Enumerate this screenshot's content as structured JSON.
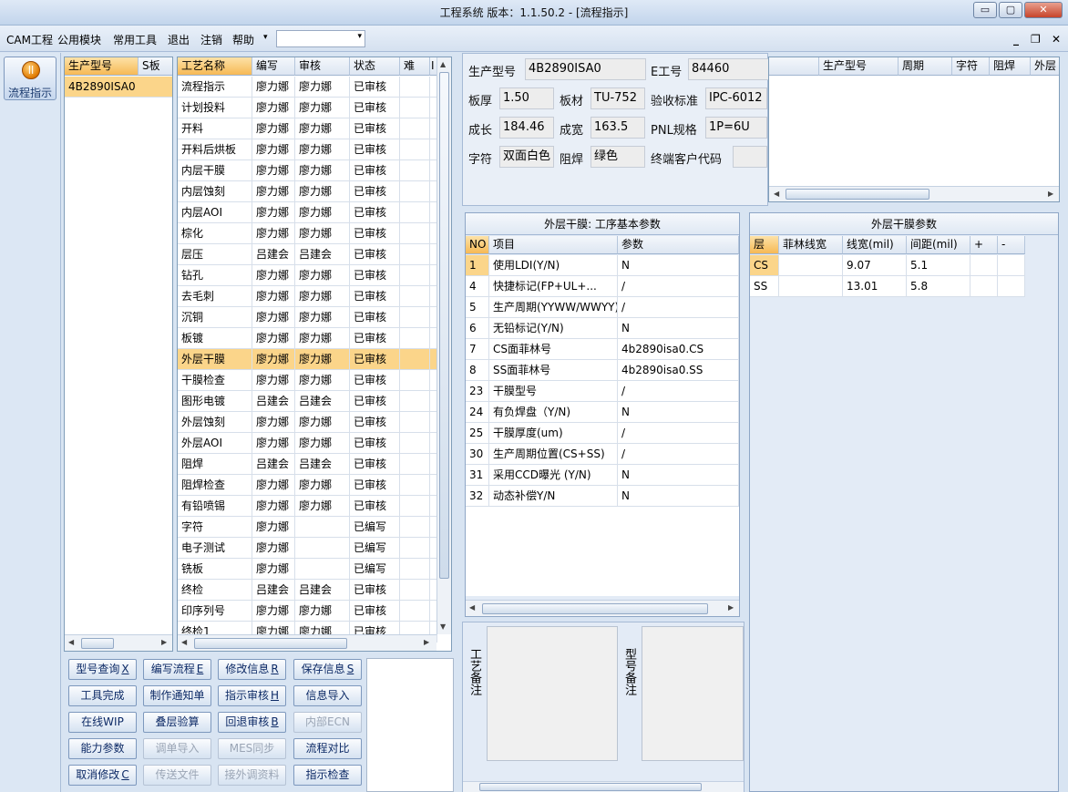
{
  "window": {
    "title": "工程系统   版本：1.1.50.2 - [流程指示]",
    "min_glyph": "▭",
    "max_glyph": "▢",
    "close_glyph": "✕"
  },
  "menu": {
    "items": [
      "CAM工程",
      "公用模块",
      "常用工具",
      "退出",
      "注销",
      "帮助"
    ],
    "dropdown_glyph": "▾",
    "combo_value": "",
    "mdi_min": "_",
    "mdi_restore": "❐",
    "mdi_close": "✕"
  },
  "launcher": {
    "flow_label": "流程指示",
    "icon_glyph": "||"
  },
  "model_grid": {
    "headers": [
      "生产型号",
      "S板"
    ],
    "rows": [
      [
        "4B2890ISA0",
        ""
      ]
    ]
  },
  "process_grid": {
    "headers": [
      "工艺名称",
      "编写",
      "审核",
      "状态",
      "难",
      "I"
    ],
    "selected_index": 13,
    "rows": [
      [
        "流程指示",
        "廖力娜",
        "廖力娜",
        "已审核"
      ],
      [
        "计划投料",
        "廖力娜",
        "廖力娜",
        "已审核"
      ],
      [
        "开料",
        "廖力娜",
        "廖力娜",
        "已审核"
      ],
      [
        "开料后烘板",
        "廖力娜",
        "廖力娜",
        "已审核"
      ],
      [
        "内层干膜",
        "廖力娜",
        "廖力娜",
        "已审核"
      ],
      [
        "内层蚀刻",
        "廖力娜",
        "廖力娜",
        "已审核"
      ],
      [
        "内层AOI",
        "廖力娜",
        "廖力娜",
        "已审核"
      ],
      [
        "棕化",
        "廖力娜",
        "廖力娜",
        "已审核"
      ],
      [
        "层压",
        "吕建会",
        "吕建会",
        "已审核"
      ],
      [
        "钻孔",
        "廖力娜",
        "廖力娜",
        "已审核"
      ],
      [
        "去毛刺",
        "廖力娜",
        "廖力娜",
        "已审核"
      ],
      [
        "沉铜",
        "廖力娜",
        "廖力娜",
        "已审核"
      ],
      [
        "板镀",
        "廖力娜",
        "廖力娜",
        "已审核"
      ],
      [
        "外层干膜",
        "廖力娜",
        "廖力娜",
        "已审核"
      ],
      [
        "干膜检查",
        "廖力娜",
        "廖力娜",
        "已审核"
      ],
      [
        "图形电镀",
        "吕建会",
        "吕建会",
        "已审核"
      ],
      [
        "外层蚀刻",
        "廖力娜",
        "廖力娜",
        "已审核"
      ],
      [
        "外层AOI",
        "廖力娜",
        "廖力娜",
        "已审核"
      ],
      [
        "阻焊",
        "吕建会",
        "吕建会",
        "已审核"
      ],
      [
        "阻焊检查",
        "廖力娜",
        "廖力娜",
        "已审核"
      ],
      [
        "有铅喷锡",
        "廖力娜",
        "廖力娜",
        "已审核"
      ],
      [
        "字符",
        "廖力娜",
        "",
        "已编写"
      ],
      [
        "电子测试",
        "廖力娜",
        "",
        "已编写"
      ],
      [
        "铣板",
        "廖力娜",
        "",
        "已编写"
      ],
      [
        "终检",
        "吕建会",
        "吕建会",
        "已审核"
      ],
      [
        "印序列号",
        "廖力娜",
        "廖力娜",
        "已审核"
      ],
      [
        "终检1",
        "廖力娜",
        "廖力娜",
        "已审核"
      ]
    ]
  },
  "actions": [
    [
      {
        "label": "型号查询",
        "key": "X",
        "enabled": true
      },
      {
        "label": "编写流程",
        "key": "E",
        "enabled": true
      },
      {
        "label": "修改信息",
        "key": "R",
        "enabled": true
      },
      {
        "label": "保存信息",
        "key": "S",
        "enabled": true
      }
    ],
    [
      {
        "label": "工具完成",
        "key": "",
        "enabled": true
      },
      {
        "label": "制作通知单",
        "key": "",
        "enabled": true
      },
      {
        "label": "指示审核",
        "key": "H",
        "enabled": true
      },
      {
        "label": "信息导入",
        "key": "",
        "enabled": true
      }
    ],
    [
      {
        "label": "在线WIP",
        "key": "",
        "enabled": true
      },
      {
        "label": "叠层验算",
        "key": "",
        "enabled": true
      },
      {
        "label": "回退审核",
        "key": "B",
        "enabled": true
      },
      {
        "label": "内部ECN",
        "key": "",
        "enabled": false
      }
    ],
    [
      {
        "label": "能力参数",
        "key": "",
        "enabled": true
      },
      {
        "label": "调单导入",
        "key": "",
        "enabled": false
      },
      {
        "label": "MES同步",
        "key": "",
        "enabled": false
      },
      {
        "label": "流程对比",
        "key": "",
        "enabled": true
      }
    ],
    [
      {
        "label": "取消修改",
        "key": "C",
        "enabled": true
      },
      {
        "label": "传送文件",
        "key": "",
        "enabled": false
      },
      {
        "label": "接外调资料",
        "key": "",
        "enabled": false
      },
      {
        "label": "指示检查",
        "key": "",
        "enabled": true
      }
    ]
  ],
  "info": {
    "prod_model_label": "生产型号",
    "prod_model": "4B2890ISA0",
    "e_no_label": "E工号",
    "e_no": "84460",
    "thickness_label": "板厚",
    "thickness": "1.50",
    "material_label": "板材",
    "material": "TU-752",
    "standard_label": "验收标准",
    "standard": "IPC-6012",
    "length_label": "成长",
    "length": "184.46",
    "width_label": "成宽",
    "width": "163.5",
    "pnl_label": "PNL规格",
    "pnl": "1P=6U",
    "char_label": "字符",
    "char": "双面白色",
    "mask_label": "阻焊",
    "mask": "绿色",
    "customer_label": "终端客户代码",
    "customer": ""
  },
  "history_grid": {
    "headers": [
      "生产型号",
      "周期",
      "字符",
      "阻焊",
      "外层"
    ]
  },
  "params_panel": {
    "title": "外层干膜: 工序基本参数",
    "headers": [
      "NO",
      "项目",
      "参数"
    ],
    "rows": [
      [
        "1",
        "使用LDI(Y/N)",
        "N"
      ],
      [
        "4",
        "快捷标记(FP+UL+...",
        "/"
      ],
      [
        "5",
        "生产周期(YYWW/WWYY)",
        "/"
      ],
      [
        "6",
        "无铅标记(Y/N)",
        "N"
      ],
      [
        "7",
        "CS面菲林号",
        "4b2890isa0.CS"
      ],
      [
        "8",
        "SS面菲林号",
        "4b2890isa0.SS"
      ],
      [
        "23",
        "干膜型号",
        "/"
      ],
      [
        "24",
        "有负焊盘（Y/N)",
        "N"
      ],
      [
        "25",
        "干膜厚度(um)",
        "/"
      ],
      [
        "30",
        "生产周期位置(CS+SS)",
        "/"
      ],
      [
        "31",
        "采用CCD曝光 (Y/N)",
        "N"
      ],
      [
        "32",
        "动态补偿Y/N",
        "N"
      ]
    ]
  },
  "film_panel": {
    "title": "外层干膜参数",
    "headers": [
      "层",
      "菲林线宽",
      "线宽(mil)",
      "间距(mil)",
      "+",
      "-"
    ],
    "rows": [
      [
        "CS",
        "",
        "9.07",
        "5.1"
      ],
      [
        "SS",
        "",
        "13.01",
        "5.8"
      ]
    ]
  },
  "notes": {
    "process_label": "工艺备注",
    "model_label": "型号备注",
    "process_note": "",
    "model_note": ""
  }
}
